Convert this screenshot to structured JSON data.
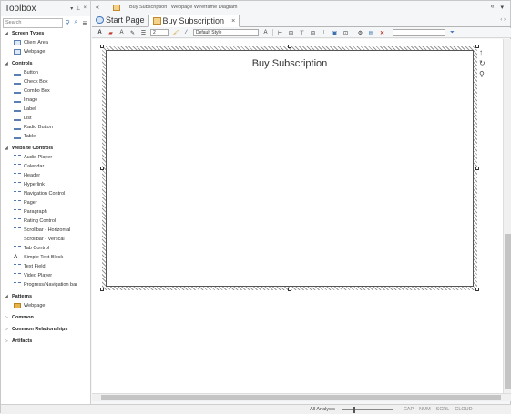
{
  "toolbox": {
    "title": "Toolbox",
    "search_placeholder": "Search",
    "categories": [
      {
        "label": "Screen Types",
        "items": [
          "Client Area",
          "Webpage"
        ]
      },
      {
        "label": "Controls",
        "items": [
          "Button",
          "Check Box",
          "Combo Box",
          "Image",
          "Label",
          "List",
          "Radio Button",
          "Table"
        ]
      },
      {
        "label": "Website Controls",
        "items": [
          "Audio Player",
          "Calendar",
          "Header",
          "Hyperlink",
          "Navigation Control",
          "Pager",
          "Paragraph",
          "Rating Control",
          "Scrollbar - Horizontal",
          "Scrollbar - Vertical",
          "Tab Control",
          "Simple Text Block",
          "Text Field",
          "Video Player",
          "Progress/Navigation bar"
        ]
      },
      {
        "label": "Patterns",
        "items": [
          "Webpage"
        ]
      },
      {
        "label": "Common",
        "items": []
      },
      {
        "label": "Common Relationships",
        "items": []
      },
      {
        "label": "Artifacts",
        "items": []
      }
    ]
  },
  "titlebar": {
    "breadcrumb": "Buy Subscription :  Webpage Wireframe Diagram"
  },
  "tabs": [
    {
      "label": "Start Page"
    },
    {
      "label": "Buy Subscription"
    }
  ],
  "toolbar": {
    "font_size": "2",
    "style": "Default Style"
  },
  "diagram": {
    "title": "Buy Subscription"
  },
  "status": {
    "analysis": "All Analysis",
    "flags": [
      "CAP",
      "NUM",
      "SCRL",
      "CLOUD"
    ]
  }
}
